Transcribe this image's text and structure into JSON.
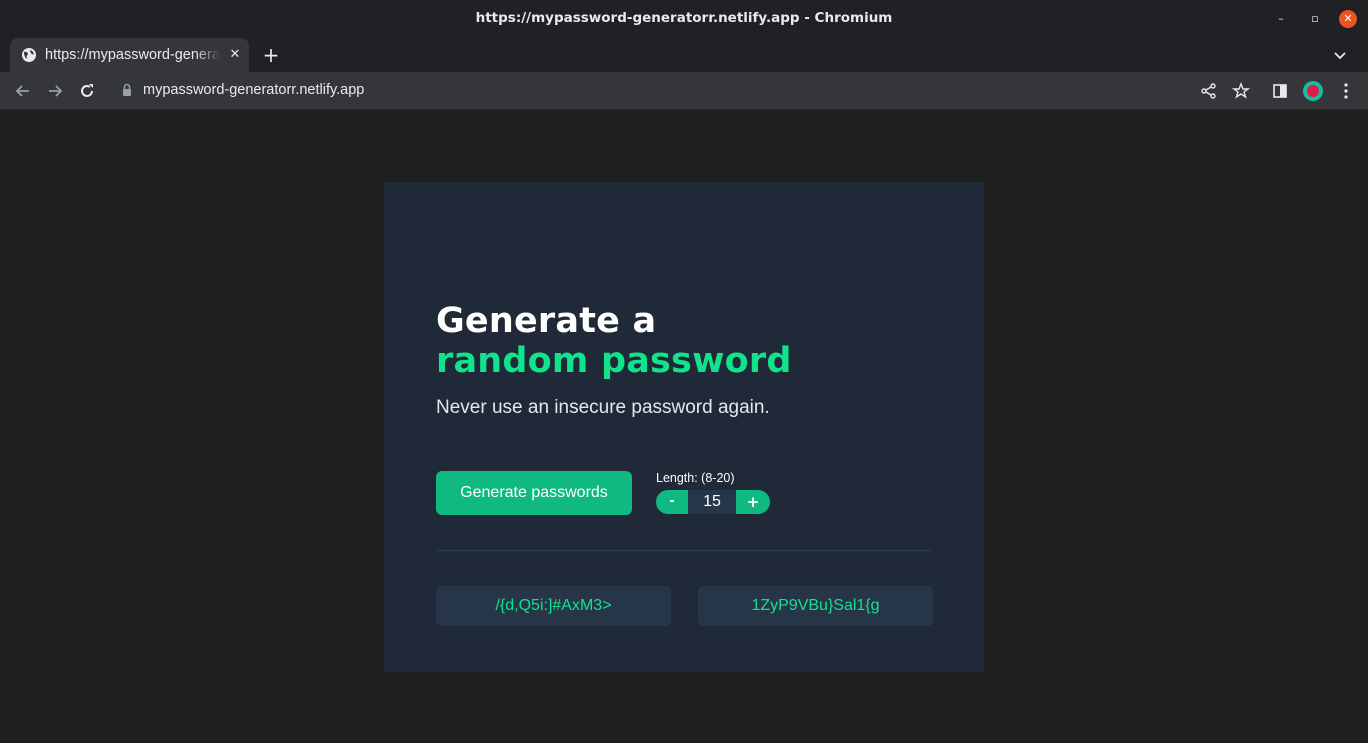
{
  "window": {
    "title": "https://mypassword-generatorr.netlify.app - Chromium",
    "minimize_glyph": "–",
    "maximize_glyph": "▫",
    "close_glyph": "✕"
  },
  "tabs": [
    {
      "title": "https://mypassword-generatorr.netlify.app",
      "favicon": "globe-icon",
      "active": true,
      "close_glyph": "✕"
    }
  ],
  "tabstrip": {
    "new_tab_glyph": "+"
  },
  "toolbar": {
    "url": "mypassword-generatorr.netlify.app",
    "icons": [
      "back-icon",
      "forward-icon",
      "reload-icon",
      "lock-icon",
      "share-icon",
      "bookmark-star-icon",
      "side-panel-icon",
      "profile-avatar",
      "menu-icon"
    ]
  },
  "page": {
    "heading_line1": "Generate a",
    "heading_line2": "random password",
    "subtitle": "Never use an insecure password again.",
    "generate_button": "Generate passwords",
    "length_label": "Length: (8-20)",
    "stepper": {
      "minus": "-",
      "value": "15",
      "plus": "+"
    },
    "passwords": [
      "/{d,Q5i:]#AxM3>",
      "1ZyP9VBu}Sal1{g"
    ],
    "colors": {
      "card_bg": "#1f2937",
      "accent_green": "#10b981",
      "accent_text_green": "#10e38c",
      "password_box_bg": "#273549"
    }
  }
}
